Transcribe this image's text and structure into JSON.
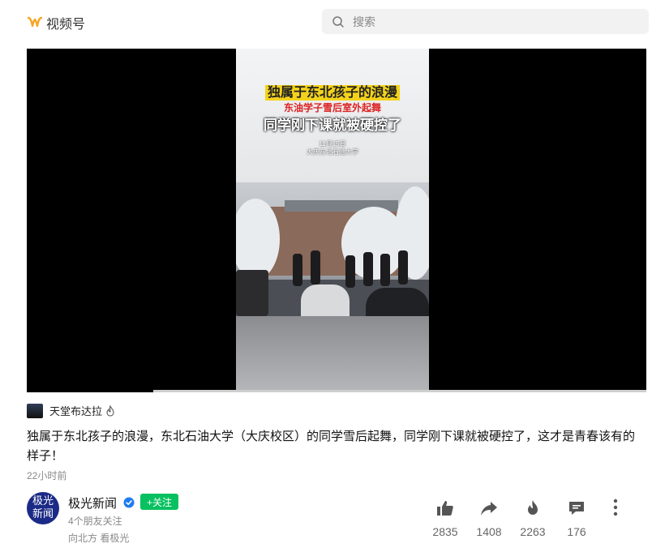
{
  "app": {
    "name": "视频号",
    "accent": "#f5a623"
  },
  "search": {
    "placeholder": "搜索"
  },
  "video": {
    "overlay": {
      "line1": "独属于东北孩子的浪漫",
      "line2": "东油学子雪后室外起舞",
      "line3": "同学刚下课就被硬控了",
      "date": "11月15日",
      "place": "大庆东北石油大学"
    },
    "progress": 0.0
  },
  "author": {
    "name": "天堂布达拉",
    "badge_icon": "fire-icon"
  },
  "post": {
    "description": "独属于东北孩子的浪漫，东北石油大学（大庆校区）的同学雪后起舞，同学刚下课就被硬控了，这才是青春该有的样子！",
    "time": "22小时前"
  },
  "channel": {
    "avatar_line1": "极光",
    "avatar_line2": "新闻",
    "name": "极光新闻",
    "follow_label": "+关注",
    "friends_following": "4个朋友关注",
    "tagline": "向北方 看极光",
    "follow_color": "#07c160"
  },
  "stats": {
    "likes": "2835",
    "shares": "1408",
    "recommends": "2263",
    "comments": "176"
  }
}
